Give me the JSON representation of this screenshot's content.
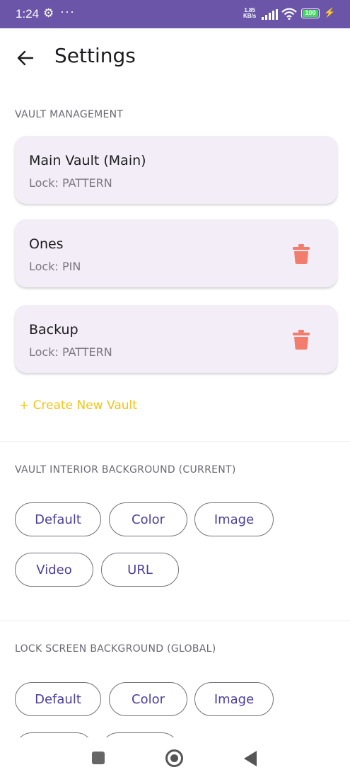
{
  "status_bar": {
    "time": "1:24",
    "icons": [
      "gear-icon",
      "more-dots-icon"
    ],
    "net_speed_value": "1.85",
    "net_speed_unit": "KB/s",
    "battery": "100",
    "battery_level": 1.0,
    "colors": {
      "bar": "#6a55a9",
      "battery_fill": "#3ddc5a"
    }
  },
  "header": {
    "back_icon": "arrow-left-icon",
    "title": "Settings"
  },
  "vault_management": {
    "label": "VAULT MANAGEMENT",
    "vaults": [
      {
        "name": "Main Vault (Main)",
        "lock": "Lock: PATTERN",
        "deletable": false
      },
      {
        "name": "Ones",
        "lock": "Lock: PIN",
        "deletable": true
      },
      {
        "name": "Backup",
        "lock": "Lock: PATTERN",
        "deletable": true
      }
    ],
    "delete_icon": "trash-icon",
    "create_label": "+ Create New Vault"
  },
  "interior_background": {
    "label": "VAULT INTERIOR BACKGROUND (CURRENT)",
    "options": [
      "Default",
      "Color",
      "Image",
      "Video",
      "URL"
    ]
  },
  "lock_background": {
    "label": "LOCK SCREEN BACKGROUND (GLOBAL)",
    "options": [
      "Default",
      "Color",
      "Image"
    ]
  },
  "nav_bar": {
    "icons": [
      "recents-square-icon",
      "home-circle-icon",
      "back-triangle-icon"
    ]
  },
  "colors": {
    "accent_text": "#4b3f9c",
    "card_bg": "#f3edf7",
    "delete": "#f27d6c",
    "create": "#f2c414"
  }
}
